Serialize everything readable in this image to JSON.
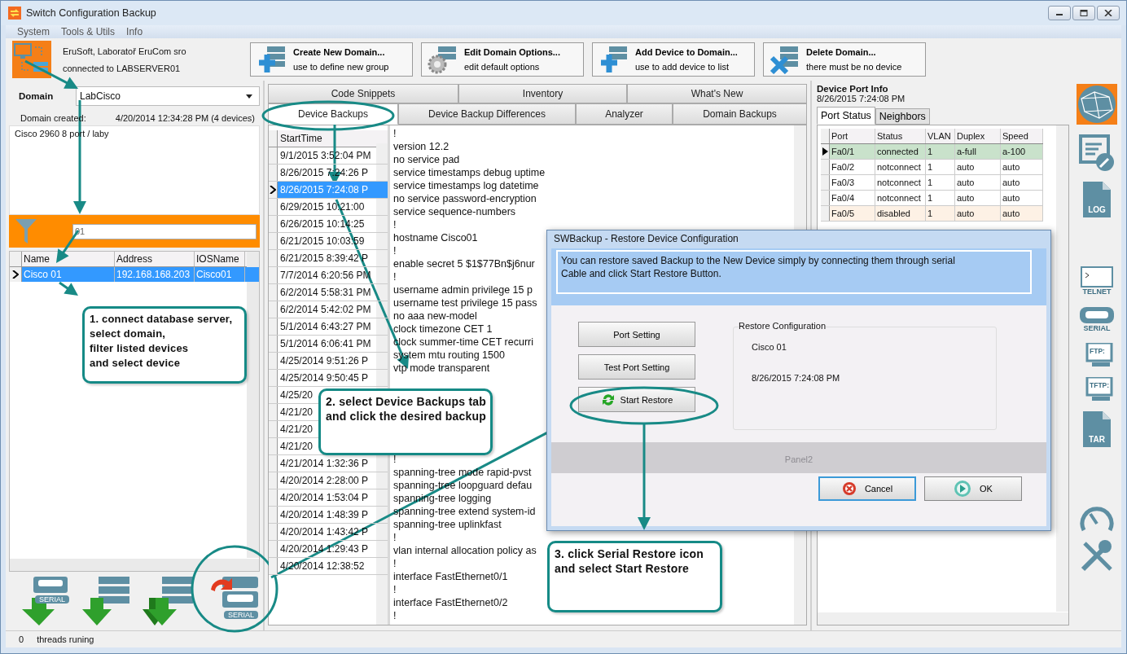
{
  "window": {
    "title": "Switch Configuration Backup"
  },
  "menu": [
    "System",
    "Tools & Utils",
    "Info"
  ],
  "connection": {
    "company": "EruSoft, Laboratoř EruCom sro",
    "status": "connected to LABSERVER01"
  },
  "toolbar": [
    {
      "kind": "create",
      "title": "Create New Domain...",
      "subtitle": "use to define new group"
    },
    {
      "kind": "edit",
      "title": "Edit Domain Options...",
      "subtitle": "edit default options"
    },
    {
      "kind": "add",
      "title": "Add Device to Domain...",
      "subtitle": "use to add device to list"
    },
    {
      "kind": "delete",
      "title": "Delete Domain...",
      "subtitle": "there must be no device"
    }
  ],
  "domain": {
    "label": "Domain",
    "value": "LabCisco",
    "created_label": "Domain created:",
    "created": "4/20/2014 12:34:28 PM (4 devices)",
    "description": "Cisco 2960 8 port / laby"
  },
  "filter": {
    "value": "01"
  },
  "devices": {
    "columns": [
      "Name",
      "Address",
      "IOSName"
    ],
    "rows": [
      {
        "cells": [
          "Cisco 01",
          "192.168.168.203",
          "Cisco01"
        ],
        "selected": true
      }
    ]
  },
  "bottom_tools": [
    {
      "kind": "serial-download",
      "label": "SERIAL"
    },
    {
      "kind": "server-download"
    },
    {
      "kind": "multi-download"
    },
    {
      "kind": "serial-restore",
      "label": "SERIAL"
    }
  ],
  "tabs_row1": [
    {
      "label": "Code Snippets",
      "selected": false
    },
    {
      "label": "Inventory",
      "selected": false
    },
    {
      "label": "What's New",
      "selected": false
    }
  ],
  "tabs_row2": [
    {
      "label": "Device Backups",
      "selected": true
    },
    {
      "label": "Device Backup Differences",
      "selected": false
    },
    {
      "label": "Analyzer",
      "selected": false
    },
    {
      "label": "Domain Backups",
      "selected": false
    }
  ],
  "backups": {
    "column": "StartTime",
    "rows": [
      {
        "time": "9/1/2015 3:52:04 PM",
        "selected": false
      },
      {
        "time": "8/26/2015 7:24:26 P",
        "selected": false
      },
      {
        "time": "8/26/2015 7:24:08 P",
        "selected": true
      },
      {
        "time": "6/29/2015 10:21:00",
        "selected": false
      },
      {
        "time": "6/26/2015 10:14:25",
        "selected": false
      },
      {
        "time": "6/21/2015 10:03:59",
        "selected": false
      },
      {
        "time": "6/21/2015 8:39:42 P",
        "selected": false
      },
      {
        "time": "7/7/2014 6:20:56 PM",
        "selected": false
      },
      {
        "time": "6/2/2014 5:58:31 PM",
        "selected": false
      },
      {
        "time": "6/2/2014 5:42:02 PM",
        "selected": false
      },
      {
        "time": "5/1/2014 6:43:27 PM",
        "selected": false
      },
      {
        "time": "5/1/2014 6:06:41 PM",
        "selected": false
      },
      {
        "time": "4/25/2014 9:51:26 P",
        "selected": false
      },
      {
        "time": "4/25/2014 9:50:45 P",
        "selected": false
      },
      {
        "time": "4/25/20",
        "selected": false
      },
      {
        "time": "4/21/20",
        "selected": false
      },
      {
        "time": "4/21/20",
        "selected": false
      },
      {
        "time": "4/21/20",
        "selected": false
      },
      {
        "time": "4/21/2014 1:32:36 P",
        "selected": false
      },
      {
        "time": "4/20/2014 2:28:00 P",
        "selected": false
      },
      {
        "time": "4/20/2014 1:53:04 P",
        "selected": false
      },
      {
        "time": "4/20/2014 1:48:39 P",
        "selected": false
      },
      {
        "time": "4/20/2014 1:43:42 P",
        "selected": false
      },
      {
        "time": "4/20/2014 1:29:43 P",
        "selected": false
      },
      {
        "time": "4/20/2014 12:38:52",
        "selected": false
      }
    ]
  },
  "config_lines": [
    "!",
    "version 12.2",
    "no service pad",
    "service timestamps debug uptime",
    "service timestamps log datetime",
    "no service password-encryption",
    "service sequence-numbers",
    "!",
    "hostname Cisco01",
    "!",
    "enable secret 5 $1$77Bn$j6nur",
    "!",
    "username admin privilege 15 p",
    "username test privilege 15 pass",
    "no aaa new-model",
    "clock timezone CET 1",
    "clock summer-time CET recurri",
    "system mtu routing 1500",
    "vtp mode transparent"
  ],
  "config_lines_after": [
    "!",
    "spanning-tree mode rapid-pvst",
    "spanning-tree loopguard defau",
    "spanning-tree logging",
    "spanning-tree extend system-id",
    "spanning-tree uplinkfast",
    "!",
    "vlan internal allocation policy as",
    "!",
    "interface FastEthernet0/1",
    "!",
    "interface FastEthernet0/2",
    "!"
  ],
  "port_info": {
    "title": "Device Port Info",
    "time": "8/26/2015 7:24:08 PM",
    "tabs": [
      {
        "label": "Port Status",
        "selected": true
      },
      {
        "label": "Neighbors",
        "selected": false
      }
    ],
    "columns": [
      "Port",
      "Status",
      "VLAN",
      "Duplex",
      "Speed"
    ],
    "rows": [
      {
        "cells": [
          "Fa0/1",
          "connected",
          "1",
          "a-full",
          "a-100"
        ],
        "color": "#c9e2cb",
        "selected": true
      },
      {
        "cells": [
          "Fa0/2",
          "notconnect",
          "1",
          "auto",
          "auto"
        ],
        "color": "#ffffff",
        "selected": false
      },
      {
        "cells": [
          "Fa0/3",
          "notconnect",
          "1",
          "auto",
          "auto"
        ],
        "color": "#ffffff",
        "selected": false
      },
      {
        "cells": [
          "Fa0/4",
          "notconnect",
          "1",
          "auto",
          "auto"
        ],
        "color": "#ffffff",
        "selected": false
      },
      {
        "cells": [
          "Fa0/5",
          "disabled",
          "1",
          "auto",
          "auto"
        ],
        "color": "#fdf1e5",
        "selected": false
      }
    ]
  },
  "side_tools": [
    {
      "kind": "globe"
    },
    {
      "kind": "edit"
    },
    {
      "kind": "log",
      "label": "LOG"
    },
    {
      "kind": "telnet",
      "label": "TELNET"
    },
    {
      "kind": "serial",
      "label": "SERIAL"
    },
    {
      "kind": "ftp",
      "label": "FTP:"
    },
    {
      "kind": "tftp",
      "label": "TFTP:"
    },
    {
      "kind": "tar",
      "label": "TAR"
    },
    {
      "kind": "gauge"
    },
    {
      "kind": "tools"
    }
  ],
  "dialog": {
    "title": "SWBackup - Restore Device Configuration",
    "info": "You can restore saved Backup to the New Device simply by connecting them through serial Cable and click Start Restore Button.",
    "buttons": [
      {
        "kind": "plain",
        "label": "Port Setting"
      },
      {
        "kind": "plain",
        "label": "Test Port Setting"
      },
      {
        "kind": "restore",
        "label": "Start Restore"
      }
    ],
    "group": {
      "title": "Restore Configuration",
      "device": "Cisco 01",
      "time": "8/26/2015 7:24:08 PM"
    },
    "panel": "Panel2",
    "actions": [
      {
        "kind": "cancel",
        "label": "Cancel",
        "focused": true
      },
      {
        "kind": "ok",
        "label": "OK",
        "focused": false
      }
    ]
  },
  "callouts": [
    {
      "lines": [
        "1. connect database server,",
        "select domain,",
        "filter listed devices",
        "and select device"
      ]
    },
    {
      "lines": [
        "2. select Device Backups tab",
        "and click the desired backup"
      ]
    },
    {
      "lines": [
        "3. click Serial Restore icon",
        "and select Start Restore"
      ]
    }
  ],
  "status_bar": {
    "count": "0",
    "text": "threads runing"
  }
}
